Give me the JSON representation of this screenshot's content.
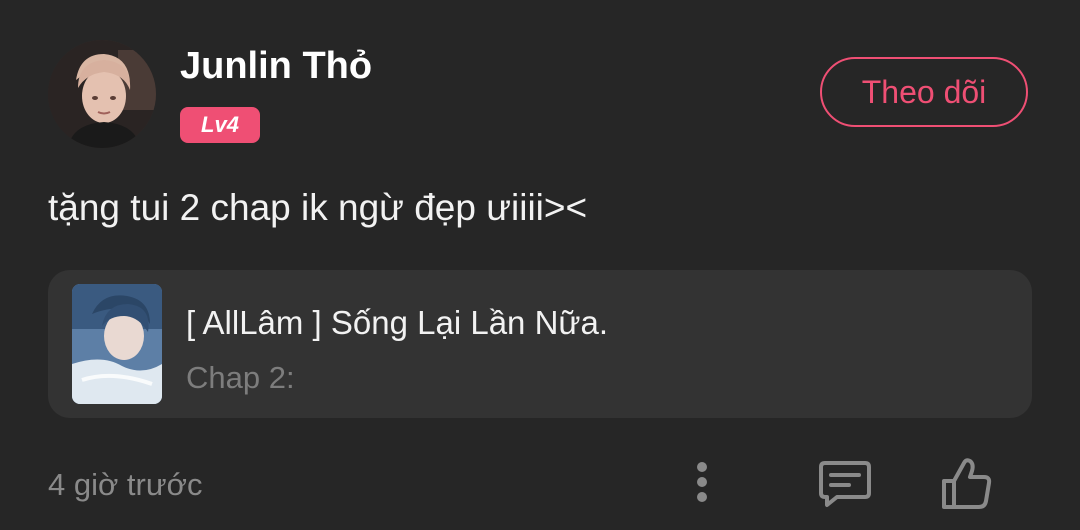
{
  "comment": {
    "user": {
      "name": "Junlin Thỏ",
      "level": "Lv4",
      "avatar_icon": "user-avatar-photo"
    },
    "follow_label": "Theo dõi",
    "text": "tặng tui 2 chap ik ngừ đẹp ưiiii><",
    "story": {
      "title": "[ AllLâm ] Sống Lại Lần Nữa.",
      "chapter": "Chap 2:",
      "cover_icon": "story-cover-image"
    },
    "timestamp": "4 giờ trước",
    "actions": {
      "more_icon": "more-vertical-icon",
      "reply_icon": "comment-icon",
      "like_icon": "thumbs-up-icon"
    }
  },
  "colors": {
    "background": "#262626",
    "card": "#333333",
    "accent": "#ef4f74",
    "muted": "#8a8a8a"
  }
}
